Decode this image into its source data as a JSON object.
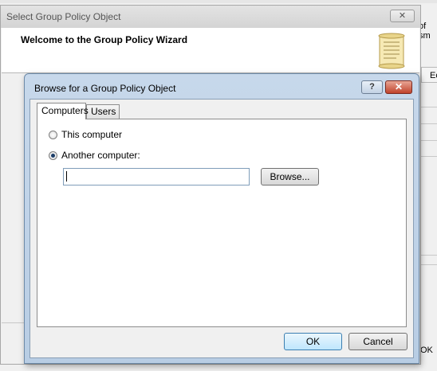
{
  "background": {
    "fragment_a": "of sm",
    "fragment_b": "Ec",
    "fragment_c": "OK"
  },
  "wizard": {
    "title": "Select Group Policy Object",
    "close_glyph": "✕",
    "heading": "Welcome to the Group Policy Wizard",
    "header_icon": "scroll-icon"
  },
  "browse_dialog": {
    "title": "Browse for a Group Policy Object",
    "help_glyph": "?",
    "close_glyph": "✕",
    "tabs": [
      {
        "label": "Computers",
        "active": true
      },
      {
        "label": "Users",
        "active": false
      }
    ],
    "options": {
      "this_computer": {
        "label": "This computer",
        "checked": false
      },
      "another_computer": {
        "label": "Another computer:",
        "checked": true
      }
    },
    "computer_name_value": "",
    "browse_button": "Browse...",
    "ok_button": "OK",
    "cancel_button": "Cancel"
  },
  "colors": {
    "dialog_frame": "#b8cde4",
    "close_button": "#c0432b",
    "default_button": "#bee6fd"
  }
}
